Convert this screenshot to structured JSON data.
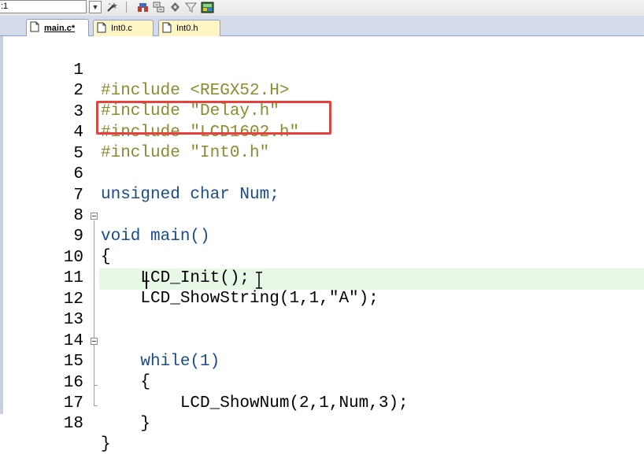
{
  "toolbar": {
    "target_value": ":1",
    "icons": [
      "dropdown-arrow-icon",
      "wand-icon",
      "build-icon",
      "translate-icon",
      "options-icon",
      "filter-icon",
      "manage-icon"
    ]
  },
  "tabs": [
    {
      "label": "main.c*",
      "active": true
    },
    {
      "label": "Int0.c",
      "active": false
    },
    {
      "label": "Int0.h",
      "active": false
    }
  ],
  "editor": {
    "current_line": 12,
    "lines": [
      {
        "num": "1",
        "code": "#include <REGX52.H>"
      },
      {
        "num": "2",
        "code": "#include \"Delay.h\""
      },
      {
        "num": "3",
        "code": "#include \"LCD1602.h\""
      },
      {
        "num": "4",
        "code": "#include \"Int0.h\""
      },
      {
        "num": "5",
        "code": ""
      },
      {
        "num": "6",
        "code": "unsigned char Num;"
      },
      {
        "num": "7",
        "code": ""
      },
      {
        "num": "8",
        "code": "void main()"
      },
      {
        "num": "9",
        "code": "{"
      },
      {
        "num": "10",
        "code": "    LCD_Init();"
      },
      {
        "num": "11",
        "code": "    LCD_ShowString(1,1,\"A\");"
      },
      {
        "num": "12",
        "code": ""
      },
      {
        "num": "13",
        "code": ""
      },
      {
        "num": "14",
        "code": "    while(1)"
      },
      {
        "num": "15",
        "code": "    {"
      },
      {
        "num": "16",
        "code": "        LCD_ShowNum(2,1,Num,3);"
      },
      {
        "num": "17",
        "code": "    }"
      },
      {
        "num": "18",
        "code": "}"
      }
    ]
  },
  "colors": {
    "preprocessor": "#8b8b2f",
    "string": "#8b1a1a",
    "keyword": "#1a4b8c",
    "number": "#1a7a8a",
    "current_line_bg": "#e8f8e6",
    "annotation_box": "#e8403a"
  }
}
